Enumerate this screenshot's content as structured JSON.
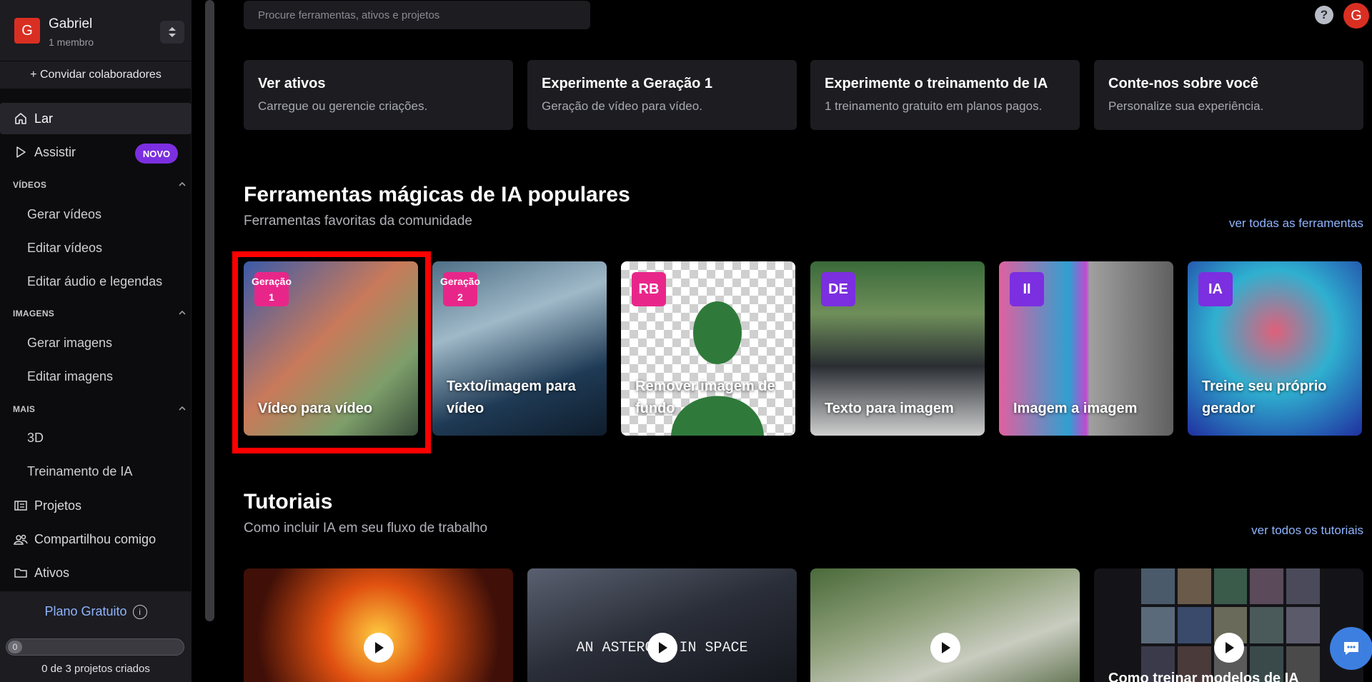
{
  "workspace": {
    "initial": "G",
    "name": "Gabriel",
    "members": "1 membro"
  },
  "sidebar": {
    "invite": "+ Convidar colaboradores",
    "home": "Lar",
    "watch": "Assistir",
    "watch_badge": "NOVO",
    "sections": {
      "videos": {
        "title": "VÍDEOS",
        "items": [
          "Gerar vídeos",
          "Editar vídeos",
          "Editar áudio e legendas"
        ]
      },
      "images": {
        "title": "IMAGENS",
        "items": [
          "Gerar imagens",
          "Editar imagens"
        ]
      },
      "more": {
        "title": "MAIS",
        "items": [
          "3D",
          "Treinamento de IA"
        ]
      }
    },
    "projects": "Projetos",
    "shared": "Compartilhou comigo",
    "assets": "Ativos",
    "plan": {
      "title": "Plano Gratuito",
      "info_icon": "i",
      "progress_value": 0,
      "progress_max": 3,
      "progress_label": "0",
      "count_text": "0 de 3 projetos criados"
    }
  },
  "header": {
    "search_placeholder": "Procure ferramentas, ativos e projetos",
    "help_icon": "?",
    "user_initial": "G"
  },
  "quick_cards": [
    {
      "title": "Ver ativos",
      "subtitle": "Carregue ou gerencie criações."
    },
    {
      "title": "Experimente a Geração 1",
      "subtitle": "Geração de vídeo para vídeo."
    },
    {
      "title": "Experimente o treinamento de IA",
      "subtitle": "1 treinamento gratuito em planos pagos."
    },
    {
      "title": "Conte-nos sobre você",
      "subtitle": "Personalize sua experiência."
    }
  ],
  "tools_section": {
    "title": "Ferramentas mágicas de IA populares",
    "subtitle": "Ferramentas favoritas da comunidade",
    "link": "ver todas as ferramentas",
    "tools": [
      {
        "badge_line1": "Geração",
        "badge_line2": "1",
        "label": "Vídeo para vídeo",
        "badge_color": "#e8268a"
      },
      {
        "badge_line1": "Geração",
        "badge_line2": "2",
        "label": "Texto/imagem para vídeo",
        "badge_color": "#e8268a"
      },
      {
        "badge": "RB",
        "label": "Remover imagem de fundo",
        "badge_color": "#e8268a"
      },
      {
        "badge": "DE",
        "label": "Texto para imagem",
        "badge_color": "#7b2fe0"
      },
      {
        "badge": "II",
        "label": "Imagem a imagem",
        "badge_color": "#7b2fe0"
      },
      {
        "badge": "IA",
        "label": "Treine seu próprio gerador",
        "badge_color": "#7b2fe0"
      }
    ]
  },
  "tutorials_section": {
    "title": "Tutoriais",
    "subtitle": "Como incluir IA em seu fluxo de trabalho",
    "link": "ver todos os tutoriais",
    "items": [
      {
        "overlay": ""
      },
      {
        "overlay": "AN ASTEROID IN SPACE"
      },
      {
        "overlay": ""
      },
      {
        "overlay": "Como treinar modelos de IA"
      }
    ]
  }
}
